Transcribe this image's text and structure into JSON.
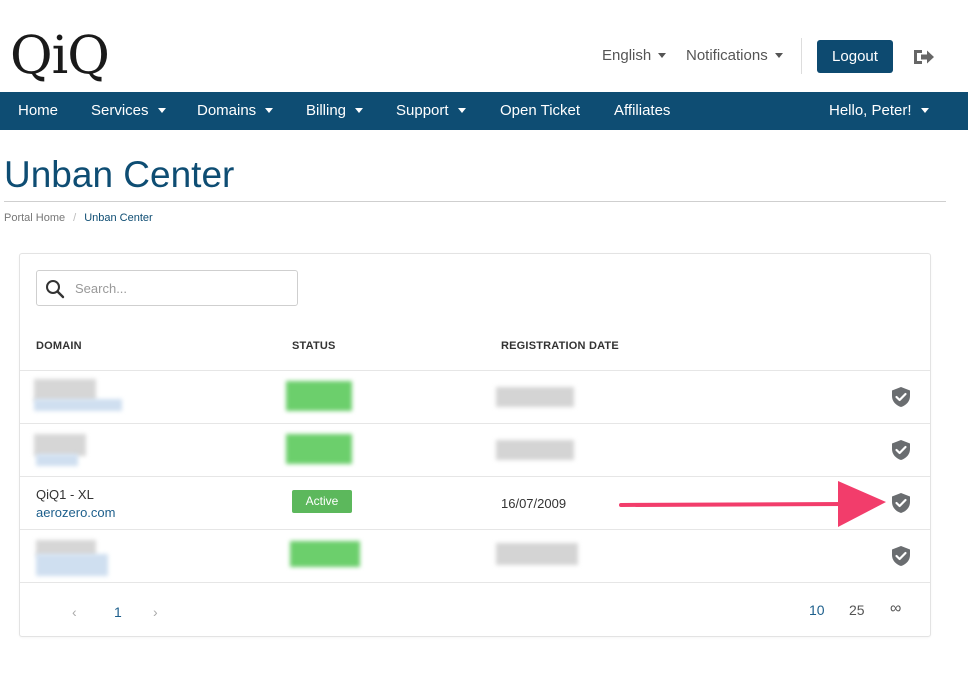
{
  "header": {
    "logo_text": "QiQ",
    "language_label": "English",
    "notifications_label": "Notifications",
    "logout_label": "Logout",
    "exit_icon": "sign-out-icon"
  },
  "nav": {
    "items": [
      {
        "label": "Home"
      },
      {
        "label": "Services"
      },
      {
        "label": "Domains"
      },
      {
        "label": "Billing"
      },
      {
        "label": "Support"
      },
      {
        "label": "Open Ticket"
      },
      {
        "label": "Affiliates"
      }
    ],
    "user_label": "Hello, Peter!"
  },
  "page": {
    "title": "Unban Center",
    "breadcrumb": [
      "Portal Home",
      "Unban Center"
    ]
  },
  "table": {
    "search_placeholder": "Search...",
    "columns": [
      "DOMAIN",
      "STATUS",
      "REGISTRATION DATE"
    ],
    "rows": [
      {
        "product": "QiQ1 - XL",
        "domain": "aerozero.com",
        "status": "Active",
        "date": "16/07/2009"
      }
    ],
    "pagination": {
      "prev": "‹",
      "current_page": "1",
      "next": "›",
      "page_sizes": [
        "10",
        "25",
        "∞"
      ]
    }
  },
  "colors": {
    "brand": "#0e4d73",
    "status_active": "#5cb85c",
    "annotation_arrow": "#f23d6b"
  }
}
